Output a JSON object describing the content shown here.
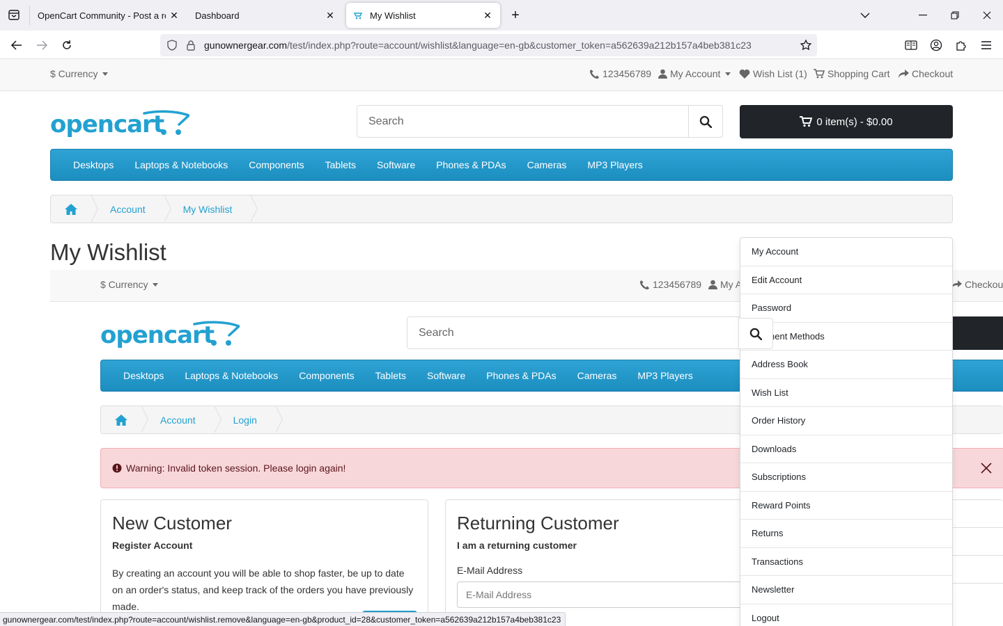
{
  "browser": {
    "tabs": [
      {
        "label": "OpenCart Community - Post a reply",
        "active": false
      },
      {
        "label": "Dashboard",
        "active": false
      },
      {
        "label": "My Wishlist",
        "active": true
      }
    ],
    "url_host": "gunownergear.com",
    "url_path": "/test/index.php?route=account/wishlist&language=en-gb&customer_token=a562639a212b157a4beb381c23",
    "status_url": "gunownergear.com/test/index.php?route=account/wishlist.remove&language=en-gb&product_id=28&customer_token=a562639a212b157a4beb381c23"
  },
  "site": {
    "currency": "$ Currency",
    "phone": "123456789",
    "my_account": "My Account",
    "wishlist": "Wish List (1)",
    "shopping_cart": "Shopping Cart",
    "checkout": "Checkout",
    "logo_text": "opencart",
    "search_placeholder": "Search",
    "cart_button": "0 item(s) - $0.00",
    "categories": [
      "Desktops",
      "Laptops & Notebooks",
      "Components",
      "Tablets",
      "Software",
      "Phones & PDAs",
      "Cameras",
      "MP3 Players"
    ],
    "breadcrumb": [
      "Account",
      "My Wishlist"
    ],
    "page_title": "My Wishlist"
  },
  "embedded": {
    "currency": "$ Currency",
    "phone": "123456789",
    "my_account_partial": "My A",
    "checkout": "Checkout",
    "search_placeholder": "Search",
    "breadcrumb": [
      "Account",
      "Login"
    ],
    "warning": "Warning: Invalid token session. Please login again!",
    "new_customer": {
      "title": "New Customer",
      "subtitle": "Register Account",
      "text": "By creating an account you will be able to shop faster, be up to date on an order's status, and keep track of the orders you have previously made."
    },
    "returning_customer": {
      "title": "Returning Customer",
      "subtitle": "I am a returning customer",
      "email_label": "E-Mail Address",
      "email_placeholder": "E-Mail Address"
    },
    "payment_partial": "ent Methods"
  },
  "account_menu": [
    "My Account",
    "Edit Account",
    "Password",
    "Payment Methods",
    "Address Book",
    "Wish List",
    "Order History",
    "Downloads",
    "Subscriptions",
    "Reward Points",
    "Returns",
    "Transactions",
    "Newsletter",
    "Logout"
  ],
  "colors": {
    "accent": "#229ac8",
    "dark": "#212529",
    "warning_bg": "#f8d7da"
  }
}
